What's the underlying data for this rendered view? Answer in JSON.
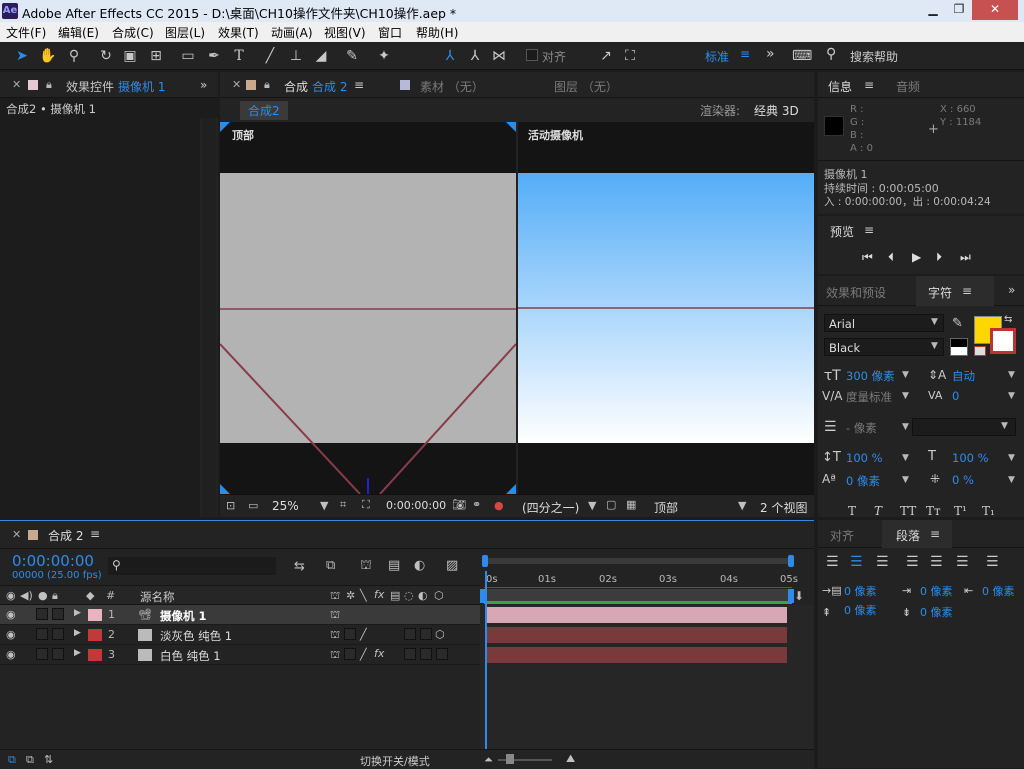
{
  "app": {
    "title": "Adobe After Effects CC 2015 - D:\\桌面\\CH10操作文件夹\\CH10操作.aep *",
    "icon_text": "Ae"
  },
  "menu": [
    "文件(F)",
    "编辑(E)",
    "合成(C)",
    "图层(L)",
    "效果(T)",
    "动画(A)",
    "视图(V)",
    "窗口",
    "帮助(H)"
  ],
  "toolbar": {
    "align_label": "对齐",
    "workspace": "标准",
    "menu_glyph": "≡",
    "search_label": "搜索帮助",
    "more_glyph": "»"
  },
  "effects_panel": {
    "title": "效果控件",
    "target": "摄像机 1",
    "breadcrumb": "合成2 • 摄像机 1"
  },
  "comp_panel": {
    "tab_prefix": "合成",
    "tab_name": "合成 2",
    "footage_tab": "素材 （无）",
    "layer_tab": "图层 （无）",
    "subtab": "合成2",
    "renderer_label": "渲染器:",
    "renderer_value": "经典 3D",
    "view_left_label": "顶部",
    "view_right_label": "活动摄像机",
    "zoom": "25%",
    "timecode": "0:00:00:00",
    "resolution": "(四分之一)",
    "view_select": "顶部",
    "view_layout": "2 个视图"
  },
  "info_panel": {
    "title": "信息",
    "audio_tab": "音频",
    "r": "R :",
    "g": "G :",
    "b": "B :",
    "a": "A : 0",
    "x": "X : 660",
    "y": "Y : 1184",
    "line1": "摄像机 1",
    "line2": "持续时间 : 0:00:05:00",
    "line3": "入 : 0:00:00:00，出 : 0:00:04:24"
  },
  "preview_panel": {
    "title": "预览"
  },
  "char_panel": {
    "effects_tab": "效果和预设",
    "title": "字符",
    "font": "Arial",
    "style": "Black",
    "size": "300 像素",
    "leading": "自动",
    "kerning": "度量标准",
    "tracking": "0",
    "stroke_width": "- 像素",
    "vscale": "100 %",
    "hscale": "100 %",
    "baseline": "0 像素",
    "tsume": "0 %",
    "fill_color": "#ffd700"
  },
  "para_panel": {
    "align_tab": "对齐",
    "title": "段落",
    "indent_left": "0 像素",
    "indent_first": "0 像素",
    "indent_right": "0 像素",
    "space_before": "0 像素",
    "space_after": "0 像素"
  },
  "timeline": {
    "tab": "合成 2",
    "timecode": "0:00:00:00",
    "frames": "00000 (25.00 fps)",
    "col_num": "#",
    "col_source": "源名称",
    "toggle_label": "切换开关/模式",
    "ruler": [
      "0s",
      "01s",
      "02s",
      "03s",
      "04s",
      "05s"
    ],
    "layers": [
      {
        "num": "1",
        "name": "摄像机 1",
        "label_color": "#e8b4c4",
        "bar_color": "#d9a6b6"
      },
      {
        "num": "2",
        "name": "淡灰色 纯色 1",
        "label_color": "#c0393b",
        "bar_color": "#7a3a3c"
      },
      {
        "num": "3",
        "name": "白色 纯色 1",
        "label_color": "#c0393b",
        "bar_color": "#7a3a3c"
      }
    ]
  }
}
